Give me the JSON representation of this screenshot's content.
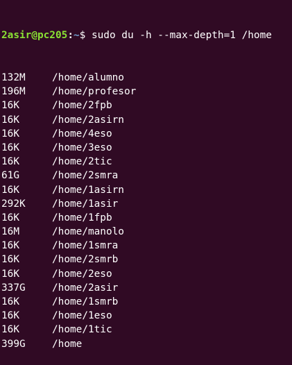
{
  "prompt": {
    "user_host": "2asir@pc205",
    "separator": ":",
    "path": "~",
    "symbol": "$ ",
    "command": "sudo du -h --max-depth=1 /home"
  },
  "rows": [
    {
      "size": "132M",
      "path": "/home/alumno"
    },
    {
      "size": "196M",
      "path": "/home/profesor"
    },
    {
      "size": "16K",
      "path": "/home/2fpb"
    },
    {
      "size": "16K",
      "path": "/home/2asirn"
    },
    {
      "size": "16K",
      "path": "/home/4eso"
    },
    {
      "size": "16K",
      "path": "/home/3eso"
    },
    {
      "size": "16K",
      "path": "/home/2tic"
    },
    {
      "size": "61G",
      "path": "/home/2smra"
    },
    {
      "size": "16K",
      "path": "/home/1asirn"
    },
    {
      "size": "292K",
      "path": "/home/1asir"
    },
    {
      "size": "16K",
      "path": "/home/1fpb"
    },
    {
      "size": "16M",
      "path": "/home/manolo"
    },
    {
      "size": "16K",
      "path": "/home/1smra"
    },
    {
      "size": "16K",
      "path": "/home/2smrb"
    },
    {
      "size": "16K",
      "path": "/home/2eso"
    },
    {
      "size": "337G",
      "path": "/home/2asir"
    },
    {
      "size": "16K",
      "path": "/home/1smrb"
    },
    {
      "size": "16K",
      "path": "/home/1eso"
    },
    {
      "size": "16K",
      "path": "/home/1tic"
    },
    {
      "size": "399G",
      "path": "/home"
    }
  ],
  "colors": {
    "background": "#300a24",
    "user_host": "#8ae234",
    "path": "#729fcf",
    "text": "#ffffff"
  }
}
